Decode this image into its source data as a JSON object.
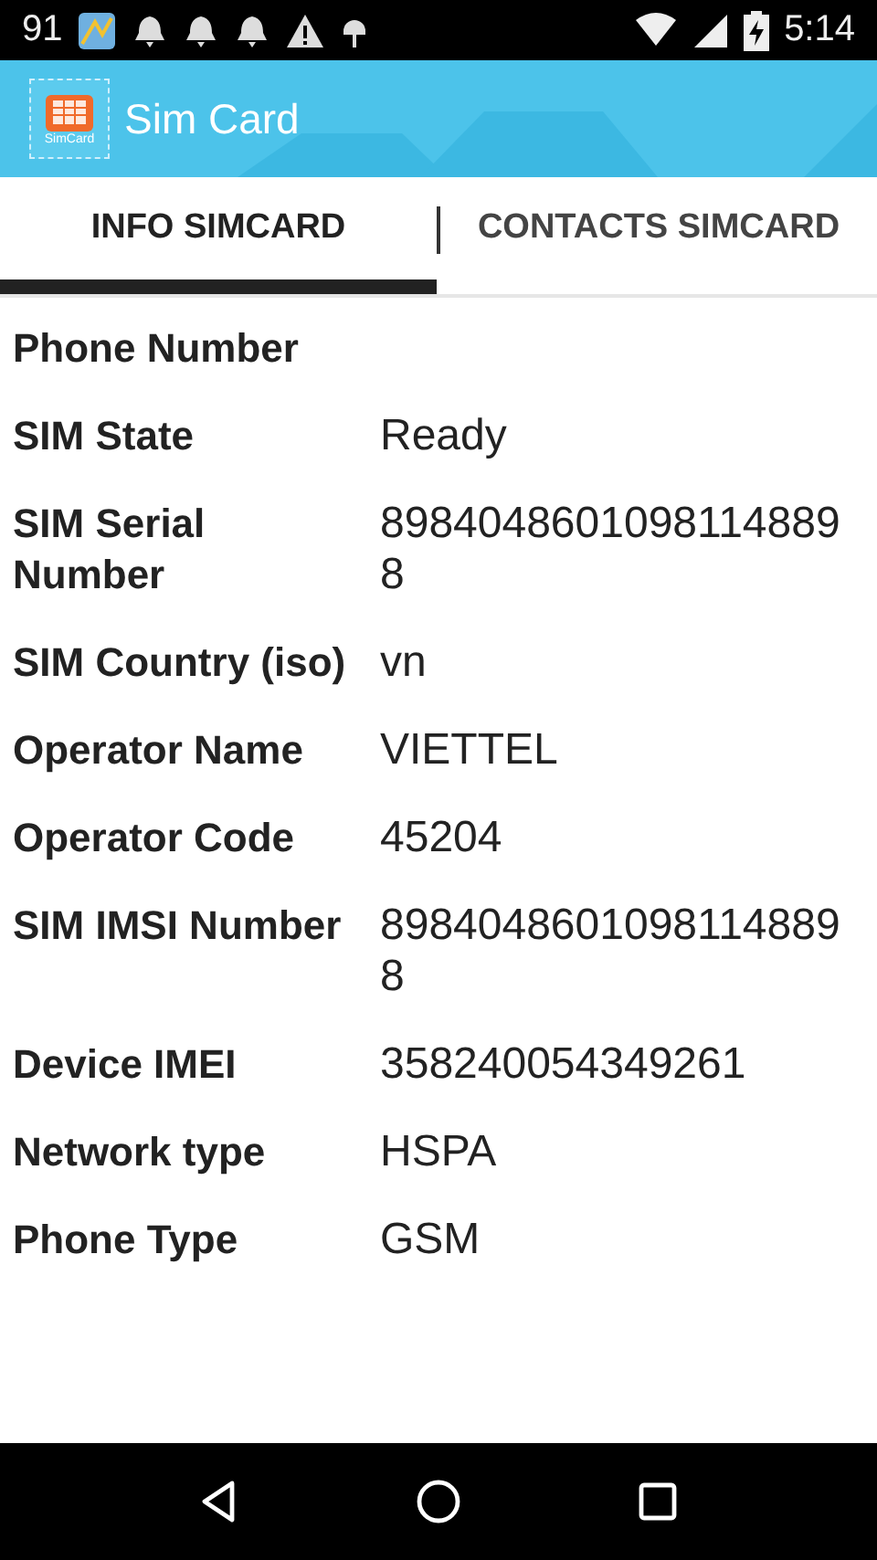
{
  "status_bar": {
    "left_text": "91",
    "time": "5:14"
  },
  "app_bar": {
    "icon_label": "SimCard",
    "title": "Sim Card"
  },
  "tabs": [
    {
      "label": "INFO SIMCARD",
      "selected": true
    },
    {
      "label": "CONTACTS SIMCARD",
      "selected": false
    }
  ],
  "info_rows": [
    {
      "label": "Phone Number"
    },
    {
      "label": "SIM State",
      "value": "Ready"
    },
    {
      "label": "SIM Serial Number",
      "value": "89840486010981148898"
    },
    {
      "label": "SIM Country (iso)",
      "value": "vn"
    },
    {
      "label": "Operator Name",
      "value": "VIETTEL"
    },
    {
      "label": "Operator Code",
      "value": "45204"
    },
    {
      "label": "SIM IMSI Number",
      "value": "89840486010981148898"
    },
    {
      "label": "Device IMEI",
      "value": "358240054349261"
    },
    {
      "label": "Network type",
      "value": "HSPA"
    },
    {
      "label": "Phone Type",
      "value": "GSM"
    }
  ]
}
